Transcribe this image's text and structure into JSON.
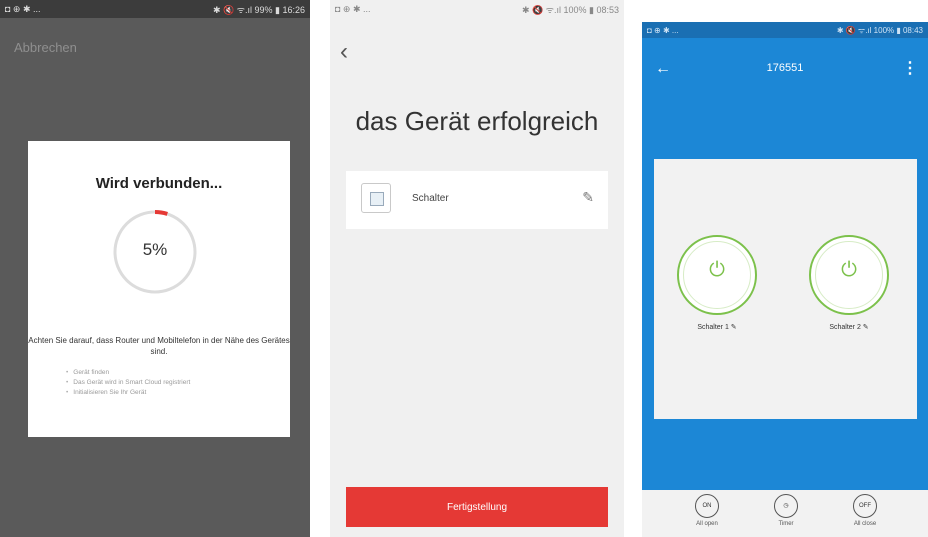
{
  "phone1": {
    "status": {
      "left": "◘ ⊕ ✱ ...",
      "right": "✱ 🔇 ᯤ.ıl 99% ▮ 16:26"
    },
    "cancel": "Abbrechen",
    "dialog": {
      "title": "Wird verbunden...",
      "progress_label": "5%",
      "progress_value": 0.05,
      "note": "Achten Sie darauf, dass Router und Mobiltelefon in der Nähe des Gerätes sind.",
      "steps": [
        "Gerät finden",
        "Das Gerät wird in Smart Cloud registriert",
        "Initialisieren Sie Ihr Gerät"
      ]
    },
    "colors": {
      "background": "#5a5a5a",
      "progress": "#e53935"
    }
  },
  "phone2": {
    "status": {
      "left": "◘ ⊕ ✱ ...",
      "right": "✱ 🔇 ᯤ.ıl 100% ▮ 08:53"
    },
    "back_icon": "chevron-left-icon",
    "title": "das Gerät erfolgreich",
    "device": {
      "name": "Schalter",
      "edit_icon": "pencil-icon"
    },
    "finish_button": "Fertigstellung",
    "colors": {
      "accent": "#e53935"
    }
  },
  "phone3": {
    "status": {
      "left": "◘ ⊕ ✱ ...",
      "right": "✱ 🔇 ᯤ.ıl 100% ▮ 08:43"
    },
    "title": "176551",
    "switches": [
      {
        "label": "Schalter 1 ✎"
      },
      {
        "label": "Schalter 2 ✎"
      }
    ],
    "bottom_buttons": [
      {
        "icon_text": "ON",
        "label": "All open"
      },
      {
        "icon_text": "◷",
        "label": "Timer"
      },
      {
        "icon_text": "OFF",
        "label": "All close"
      }
    ],
    "colors": {
      "header": "#1c87d6",
      "switch": "#7cc14b"
    }
  }
}
